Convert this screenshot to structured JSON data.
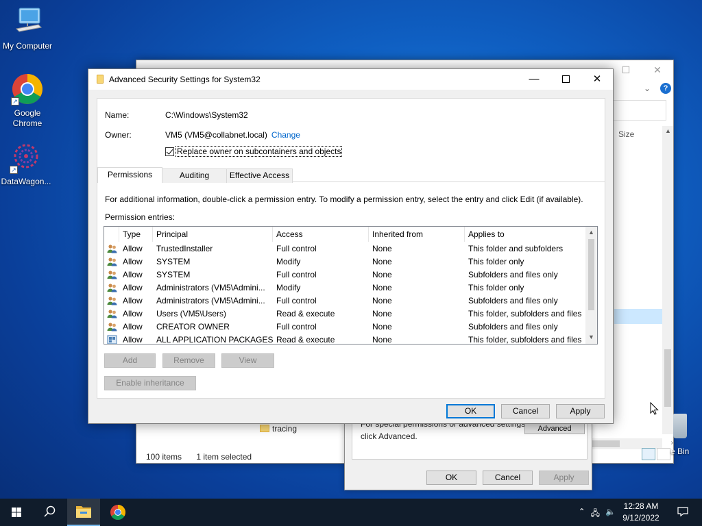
{
  "desktop": {
    "icons": [
      {
        "label": "My Computer"
      },
      {
        "label": "Google Chrome"
      },
      {
        "label": "DataWagon..."
      }
    ],
    "recycle_bin_label": "e Bin"
  },
  "explorer": {
    "size_header": "Size",
    "folder_item": "tracing",
    "status_items": "100 items",
    "status_selected": "1 item selected"
  },
  "properties": {
    "hint_line1": "For special permissions or advanced settings,",
    "hint_line2": "click Advanced.",
    "advanced_label": "Advanced",
    "ok_label": "OK",
    "cancel_label": "Cancel",
    "apply_label": "Apply"
  },
  "dialog": {
    "title": "Advanced Security Settings for System32",
    "name_label": "Name:",
    "name_value": "C:\\Windows\\System32",
    "owner_label": "Owner:",
    "owner_value": "VM5 (VM5@collabnet.local)",
    "change_link": "Change",
    "replace_owner_label": "Replace owner on subcontainers and objects",
    "replace_owner_checked": true,
    "tabs": [
      {
        "label": "Permissions",
        "active": true
      },
      {
        "label": "Auditing",
        "active": false
      },
      {
        "label": "Effective Access",
        "active": false
      }
    ],
    "info_text": "For additional information, double-click a permission entry. To modify a permission entry, select the entry and click Edit (if available).",
    "entries_label": "Permission entries:",
    "columns": [
      "Type",
      "Principal",
      "Access",
      "Inherited from",
      "Applies to"
    ],
    "entries": [
      {
        "type": "Allow",
        "principal": "TrustedInstaller",
        "access": "Full control",
        "inherited": "None",
        "applies": "This folder and subfolders"
      },
      {
        "type": "Allow",
        "principal": "SYSTEM",
        "access": "Modify",
        "inherited": "None",
        "applies": "This folder only"
      },
      {
        "type": "Allow",
        "principal": "SYSTEM",
        "access": "Full control",
        "inherited": "None",
        "applies": "Subfolders and files only"
      },
      {
        "type": "Allow",
        "principal": "Administrators (VM5\\Admini...",
        "access": "Modify",
        "inherited": "None",
        "applies": "This folder only"
      },
      {
        "type": "Allow",
        "principal": "Administrators (VM5\\Admini...",
        "access": "Full control",
        "inherited": "None",
        "applies": "Subfolders and files only"
      },
      {
        "type": "Allow",
        "principal": "Users (VM5\\Users)",
        "access": "Read & execute",
        "inherited": "None",
        "applies": "This folder, subfolders and files"
      },
      {
        "type": "Allow",
        "principal": "CREATOR OWNER",
        "access": "Full control",
        "inherited": "None",
        "applies": "Subfolders and files only"
      },
      {
        "type": "Allow",
        "principal": "ALL APPLICATION PACKAGES",
        "access": "Read & execute",
        "inherited": "None",
        "applies": "This folder, subfolders and files"
      }
    ],
    "add_label": "Add",
    "remove_label": "Remove",
    "view_label": "View",
    "enable_inheritance_label": "Enable inheritance",
    "ok_label": "OK",
    "cancel_label": "Cancel",
    "apply_label": "Apply"
  },
  "taskbar": {
    "time": "12:28 AM",
    "date": "9/12/2022"
  },
  "colors": {
    "accent": "#0078d7",
    "link": "#0066cc",
    "taskbar": "#101c2b"
  }
}
